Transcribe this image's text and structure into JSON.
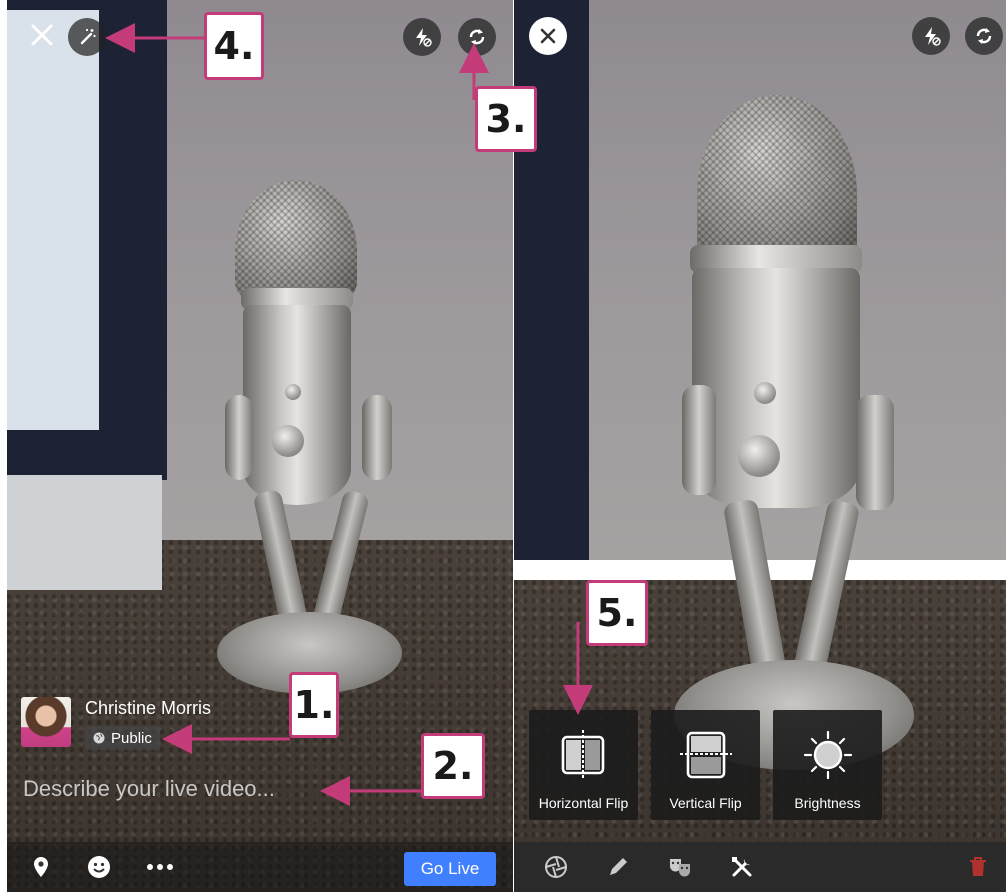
{
  "left": {
    "user_name": "Christine Morris",
    "privacy_label": "Public",
    "describe_placeholder": "Describe your live video...",
    "go_live_label": "Go Live",
    "top_icons": [
      "close-icon",
      "magic-wand-icon",
      "flash-off-icon",
      "switch-camera-icon"
    ],
    "bottom_icons": [
      "location-pin-icon",
      "smiley-icon",
      "more-icon"
    ]
  },
  "right": {
    "effects": [
      {
        "label": "Horizontal Flip",
        "icon": "horizontal-flip-icon"
      },
      {
        "label": "Vertical Flip",
        "icon": "vertical-flip-icon"
      },
      {
        "label": "Brightness",
        "icon": "brightness-icon"
      }
    ],
    "top_icons": [
      "close-icon",
      "flash-off-icon",
      "switch-camera-icon"
    ],
    "bottom_icons": [
      "aperture-icon",
      "pencil-icon",
      "masks-icon",
      "tools-icon",
      "trash-icon"
    ]
  },
  "callouts": [
    "1.",
    "2.",
    "3.",
    "4.",
    "5."
  ],
  "colors": {
    "accent": "#c43b7a",
    "go_live": "#4080ff",
    "trash": "#b0312d"
  }
}
